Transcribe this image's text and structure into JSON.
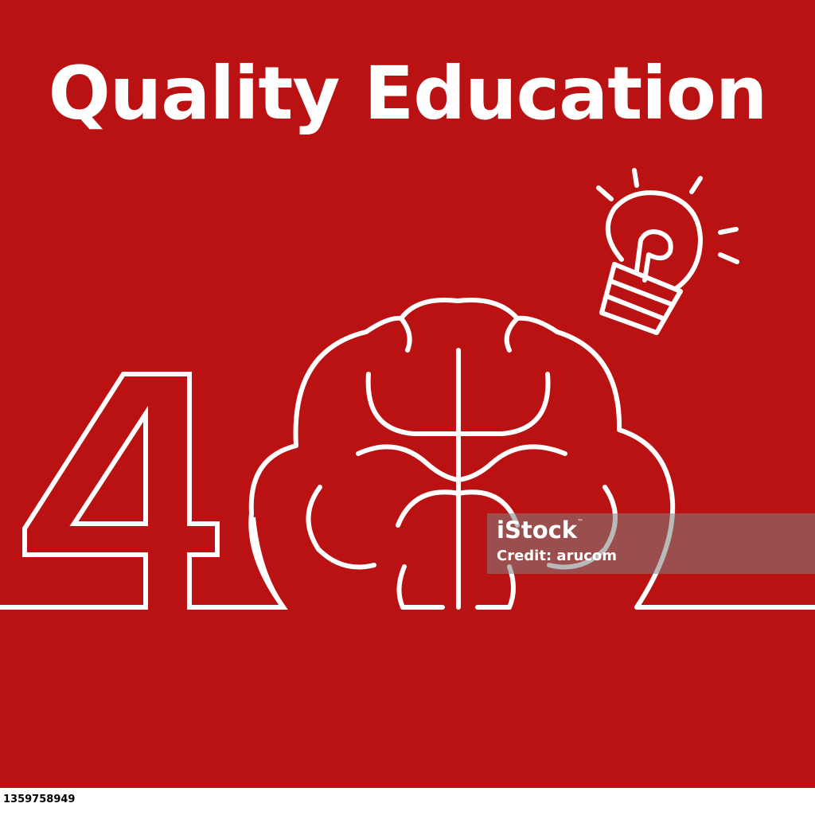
{
  "title": "Quality Education",
  "goal_number": "4",
  "watermark": {
    "brand": "iStock",
    "trademark": "™",
    "credit": "Credit: arucom"
  },
  "image_id": "1359758949",
  "colors": {
    "background": "#BA1212",
    "line": "#FFFFFF",
    "watermark_band": "#808080",
    "footer": "#FFFFFF"
  },
  "icons": [
    "number-four-outline",
    "brain-icon",
    "lightbulb-icon"
  ]
}
